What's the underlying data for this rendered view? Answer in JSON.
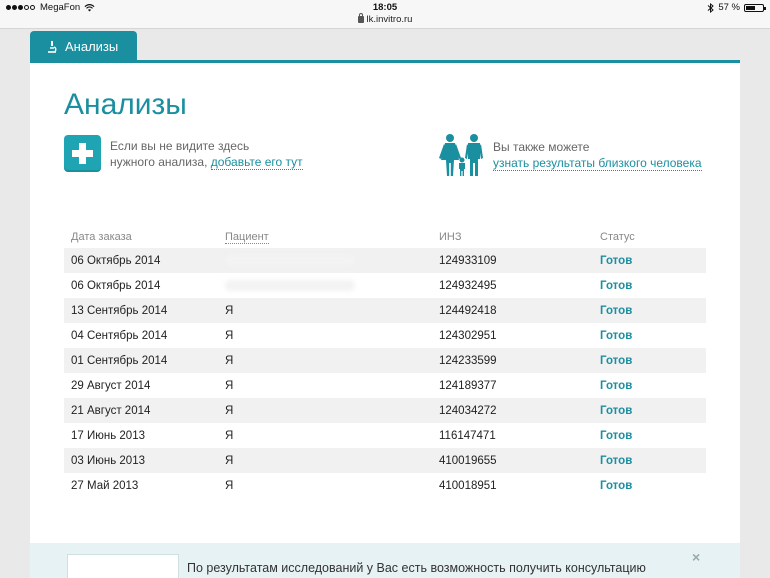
{
  "status_bar": {
    "carrier": "MegaFon",
    "time": "18:05",
    "battery": "57 %",
    "battery_level": 0.57,
    "icons": [
      "signal-dots-icon",
      "wifi-icon",
      "bluetooth-icon",
      "battery-icon"
    ]
  },
  "browser": {
    "url": "lk.invitro.ru"
  },
  "tab": {
    "label": "Анализы",
    "icon": "microscope-icon"
  },
  "page": {
    "title": "Анализы"
  },
  "promo_add": {
    "text_line1": "Если вы не видите здесь",
    "text_line2": "нужного анализа,",
    "link": "добавьте его тут",
    "icon": "plus-icon"
  },
  "promo_family": {
    "text_line1": "Вы также можете",
    "link": "узнать результаты близкого человека",
    "icon": "family-icon"
  },
  "table": {
    "headers": {
      "date": "Дата заказа",
      "patient": "Пациент",
      "inz": "ИНЗ",
      "status": "Статус"
    },
    "rows": [
      {
        "date": "06 Октябрь 2014",
        "patient": "",
        "inz": "124933109",
        "status": "Готов"
      },
      {
        "date": "06 Октябрь 2014",
        "patient": "",
        "inz": "124932495",
        "status": "Готов"
      },
      {
        "date": "13 Сентябрь 2014",
        "patient": "Я",
        "inz": "124492418",
        "status": "Готов"
      },
      {
        "date": "04 Сентябрь 2014",
        "patient": "Я",
        "inz": "124302951",
        "status": "Готов"
      },
      {
        "date": "01 Сентябрь 2014",
        "patient": "Я",
        "inz": "124233599",
        "status": "Готов"
      },
      {
        "date": "29 Август 2014",
        "patient": "Я",
        "inz": "124189377",
        "status": "Готов"
      },
      {
        "date": "21 Август 2014",
        "patient": "Я",
        "inz": "124034272",
        "status": "Готов"
      },
      {
        "date": "17 Июнь 2013",
        "patient": "Я",
        "inz": "116147471",
        "status": "Готов"
      },
      {
        "date": "03 Июнь 2013",
        "patient": "Я",
        "inz": "410019655",
        "status": "Готов"
      },
      {
        "date": "27 Май 2013",
        "patient": "Я",
        "inz": "410018951",
        "status": "Готов"
      }
    ]
  },
  "banner": {
    "text": "По результатам исследований у Вас есть возможность получить консультацию",
    "close": "×"
  },
  "colors": {
    "accent": "#1a8fa0",
    "plus_box": "#1fa4b3",
    "row_stripe": "#f1f1f1",
    "banner_bg": "#e6f2f4"
  }
}
